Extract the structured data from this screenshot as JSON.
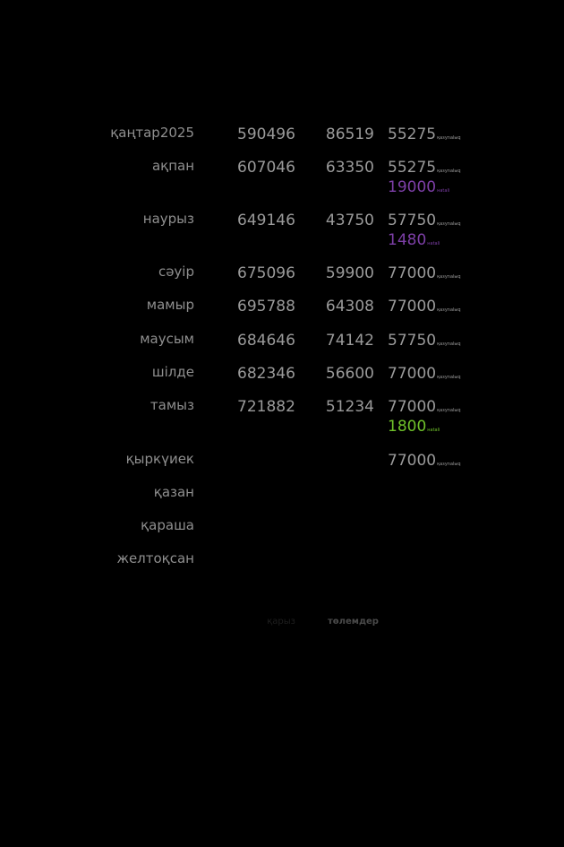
{
  "colors": {
    "background": "#000000",
    "text": "#9a9a9a",
    "label": "#8f8f8f",
    "purple": "#7d3fa7",
    "green": "#6fc12a"
  },
  "rows": [
    {
      "month": "қаңтар2025",
      "debt": "590496",
      "payment": "86519",
      "extras": [
        {
          "amount": "55275",
          "tag": "қазynalыq",
          "color": "#9a9a9a"
        }
      ]
    },
    {
      "month": "ақпан",
      "debt": "607046",
      "payment": "63350",
      "extras": [
        {
          "amount": "55275",
          "tag": "қазynalыq",
          "color": "#9a9a9a"
        },
        {
          "amount": "19000",
          "tag": "наtalі",
          "color": "#7d3fa7"
        }
      ]
    },
    {
      "month": "наурыз",
      "debt": "649146",
      "payment": "43750",
      "extras": [
        {
          "amount": "57750",
          "tag": "қазynalыq",
          "color": "#9a9a9a"
        },
        {
          "amount": "1480",
          "tag": "наtalі",
          "color": "#7d3fa7"
        }
      ]
    },
    {
      "month": "сәуір",
      "debt": "675096",
      "payment": "59900",
      "extras": [
        {
          "amount": "77000",
          "tag": "қазynalыq",
          "color": "#9a9a9a"
        }
      ]
    },
    {
      "month": "мамыр",
      "debt": "695788",
      "payment": "64308",
      "extras": [
        {
          "amount": "77000",
          "tag": "қазynalыq",
          "color": "#9a9a9a"
        }
      ]
    },
    {
      "month": "маусым",
      "debt": "684646",
      "payment": "74142",
      "extras": [
        {
          "amount": "57750",
          "tag": "қазynalыq",
          "color": "#9a9a9a"
        }
      ]
    },
    {
      "month": "шілде",
      "debt": "682346",
      "payment": "56600",
      "extras": [
        {
          "amount": "77000",
          "tag": "қазynalыq",
          "color": "#9a9a9a"
        }
      ]
    },
    {
      "month": "тамыз",
      "debt": "721882",
      "payment": "51234",
      "extras": [
        {
          "amount": "77000",
          "tag": "қазynalыq",
          "color": "#9a9a9a"
        },
        {
          "amount": "1800",
          "tag": "наtalі",
          "color": "#6fc12a"
        }
      ]
    },
    {
      "month": "қыркүиек",
      "debt": "",
      "payment": "",
      "extras": [
        {
          "amount": "77000",
          "tag": "қазynalыq",
          "color": "#9a9a9a"
        }
      ]
    },
    {
      "month": "қазан",
      "debt": "",
      "payment": "",
      "extras": []
    },
    {
      "month": "қараша",
      "debt": "",
      "payment": "",
      "extras": []
    },
    {
      "month": "желтоқсан",
      "debt": "",
      "payment": "",
      "extras": []
    }
  ],
  "footer": {
    "debt_label": "қарыз",
    "payments_label": "төлемдер"
  }
}
